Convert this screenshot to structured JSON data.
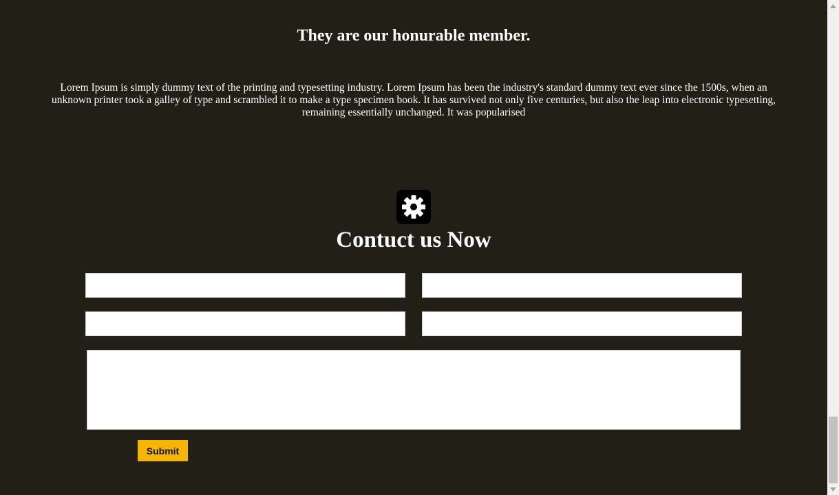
{
  "members": {
    "title": "They are our honurable member.",
    "description": "Lorem Ipsum is simply dummy text of the printing and typesetting industry. Lorem Ipsum has been the industry's standard dummy text ever since the 1500s, when an unknown printer took a galley of type and scrambled it to make a type specimen book. It has survived not only five centuries, but also the leap into electronic typesetting, remaining essentially unchanged. It was popularised"
  },
  "contact": {
    "icon": "gear-icon",
    "title": "Contuct us Now",
    "fields": [
      {
        "value": "",
        "placeholder": ""
      },
      {
        "value": "",
        "placeholder": ""
      },
      {
        "value": "",
        "placeholder": ""
      },
      {
        "value": "",
        "placeholder": ""
      }
    ],
    "message": {
      "value": "",
      "placeholder": ""
    },
    "submit_label": "Submit"
  },
  "colors": {
    "background": "#221f17",
    "accent": "#f7b500",
    "text": "#ffffff"
  }
}
